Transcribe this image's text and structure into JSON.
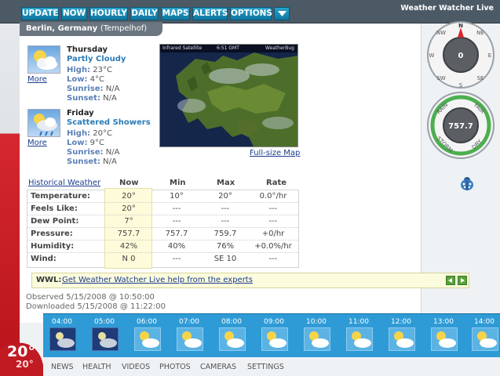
{
  "app": {
    "title": "Weather Watcher Live"
  },
  "nav": {
    "buttons": [
      {
        "label": "UPDATE"
      },
      {
        "label": "NOW"
      },
      {
        "label": "HOURLY"
      },
      {
        "label": "DAILY"
      },
      {
        "label": "MAPS"
      },
      {
        "label": "ALERTS"
      },
      {
        "label": "OPTIONS"
      }
    ]
  },
  "location": {
    "city": "Berlin, Germany",
    "area": "(Tempelhof)"
  },
  "forecast_days": [
    {
      "name": "Thursday",
      "condition": "Partly Cloudy",
      "icon": "partly-cloudy-icon",
      "high_label": "High:",
      "high": "23°C",
      "low_label": "Low:",
      "low": "4°C",
      "sunrise_label": "Sunrise:",
      "sunrise": "N/A",
      "sunset_label": "Sunset:",
      "sunset": "N/A",
      "more": "More"
    },
    {
      "name": "Friday",
      "condition": "Scattered Showers",
      "icon": "scattered-showers-icon",
      "high_label": "High:",
      "high": "20°C",
      "low_label": "Low:",
      "low": "9°C",
      "sunrise_label": "Sunrise:",
      "sunrise": "N/A",
      "sunset_label": "Sunset:",
      "sunset": "N/A",
      "more": "More"
    }
  ],
  "map": {
    "left_label": "Infrared Satellite",
    "time": "6:51 GMT",
    "brand": "WeatherBug",
    "fullsize_link": "Full-size Map"
  },
  "conditions": {
    "historical_link": "Historical Weather",
    "headers": [
      "Now",
      "Min",
      "Max",
      "Rate"
    ],
    "rows": [
      {
        "label": "Temperature:",
        "now": "20°",
        "min": "10°",
        "max": "20°",
        "rate": "0.0°/hr"
      },
      {
        "label": "Feels Like:",
        "now": "20°",
        "min": "---",
        "max": "---",
        "rate": "---"
      },
      {
        "label": "Dew Point:",
        "now": "7°",
        "min": "---",
        "max": "---",
        "rate": "---"
      },
      {
        "label": "Pressure:",
        "now": "757.7",
        "min": "757.7",
        "max": "759.7",
        "rate": "+0/hr"
      },
      {
        "label": "Humidity:",
        "now": "42%",
        "min": "40%",
        "max": "76%",
        "rate": "+0.0%/hr"
      },
      {
        "label": "Wind:",
        "now": "N 0",
        "min": "---",
        "max": "SE 10",
        "rate": "---"
      }
    ]
  },
  "wwl": {
    "label": "WWL:",
    "link": "Get Weather Watcher Live help from the experts"
  },
  "observed": {
    "observed": "Observed 5/15/2008 @ 10:50:00",
    "downloaded": "Downloaded 5/15/2008 @ 11:22:00"
  },
  "compass": {
    "n": "N",
    "ne": "NE",
    "nw": "NW",
    "e": "E",
    "w": "W",
    "se": "SE",
    "sw": "SW",
    "s": "S",
    "value": "0"
  },
  "barometer": {
    "rain": "RAIN",
    "fair": "FAIR",
    "storm": "STORM",
    "dry": "DRY",
    "value": "757.7"
  },
  "hourly": [
    {
      "time": "04:00",
      "icon": "night-cloudy-icon",
      "night": true
    },
    {
      "time": "05:00",
      "icon": "night-cloudy-icon",
      "night": true
    },
    {
      "time": "06:00",
      "icon": "partly-cloudy-icon",
      "night": false
    },
    {
      "time": "07:00",
      "icon": "partly-cloudy-icon",
      "night": false
    },
    {
      "time": "08:00",
      "icon": "partly-cloudy-icon",
      "night": false
    },
    {
      "time": "09:00",
      "icon": "partly-cloudy-icon",
      "night": false
    },
    {
      "time": "10:00",
      "icon": "partly-cloudy-icon",
      "night": false
    },
    {
      "time": "11:00",
      "icon": "partly-cloudy-icon",
      "night": false
    },
    {
      "time": "12:00",
      "icon": "partly-cloudy-icon",
      "night": false
    },
    {
      "time": "13:00",
      "icon": "partly-cloudy-icon",
      "night": false
    },
    {
      "time": "14:00",
      "icon": "partly-cloudy-icon",
      "night": false
    }
  ],
  "bottom_nav": [
    {
      "label": "NEWS"
    },
    {
      "label": "HEALTH"
    },
    {
      "label": "VIDEOS"
    },
    {
      "label": "PHOTOS"
    },
    {
      "label": "CAMERAS"
    },
    {
      "label": "SETTINGS"
    }
  ],
  "current_temp": {
    "large": "20°",
    "small": "20°"
  },
  "colors": {
    "accent": "#0f76a0",
    "link": "#1a3c8c",
    "forecast_bar": "#2e9bd6",
    "temp_red": "#d5272f",
    "condition_blue": "#2b7bb7"
  }
}
